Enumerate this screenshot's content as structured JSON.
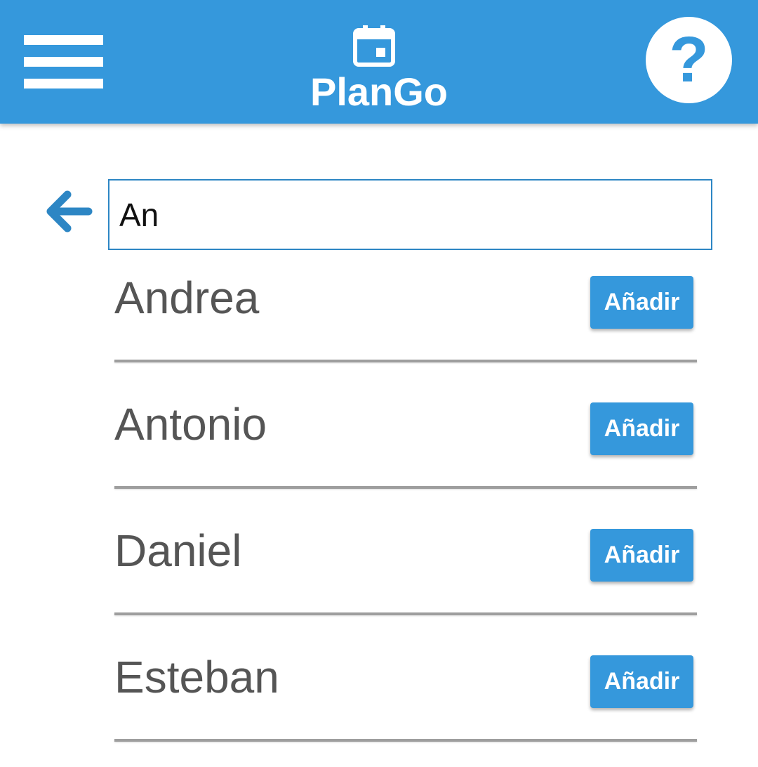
{
  "header": {
    "title": "PlanGo",
    "menu_icon": "hamburger-menu-icon",
    "calendar_icon": "calendar-icon",
    "help_icon": "help-icon",
    "help_glyph": "?",
    "background_color": "#3598dc"
  },
  "search": {
    "back_icon": "arrow-back-icon",
    "value": "An",
    "border_color": "#2d86c4"
  },
  "results": [
    {
      "name": "Andrea",
      "action_label": "Añadir"
    },
    {
      "name": "Antonio",
      "action_label": "Añadir"
    },
    {
      "name": "Daniel",
      "action_label": "Añadir"
    },
    {
      "name": "Esteban",
      "action_label": "Añadir"
    }
  ],
  "colors": {
    "accent": "#3598dc",
    "name_text": "#555555",
    "divider": "#9e9e9e"
  }
}
